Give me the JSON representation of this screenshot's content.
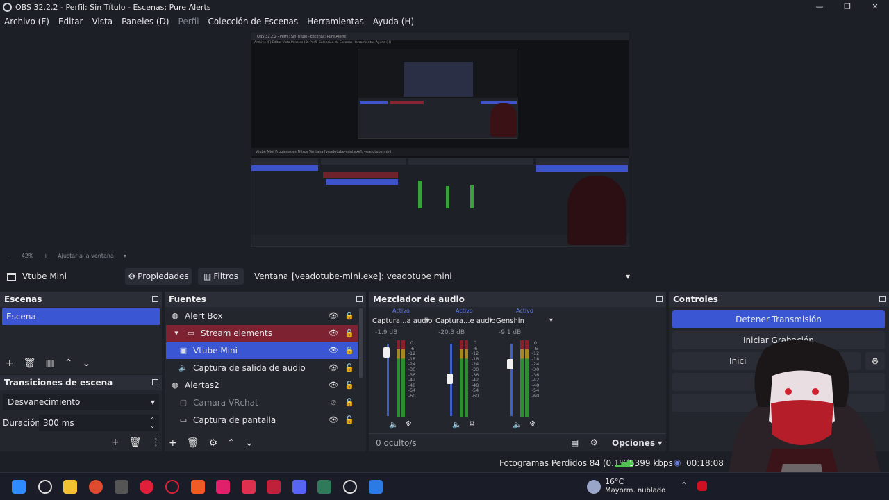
{
  "window": {
    "title": "OBS 32.2.2 - Perfil: Sin Título - Escenas: Pure Alerts",
    "controls": [
      "—",
      "❐",
      "✕"
    ]
  },
  "menu": [
    "Archivo (F)",
    "Editar",
    "Vista",
    "Paneles (D)",
    "Perfil",
    "Colección de Escenas",
    "Herramientas",
    "Ayuda (H)"
  ],
  "zoom": {
    "minus": "−",
    "level": "42%",
    "plus": "+",
    "fit": "Ajustar a la ventana"
  },
  "source_bar": {
    "current": "Vtube Mini",
    "properties": "Propiedades",
    "filters": "Filtros",
    "window_label": "Ventana",
    "window_value": "[veadotube-mini.exe]: veadotube mini"
  },
  "scenes": {
    "header": "Escenas",
    "items": [
      "Escena"
    ]
  },
  "transitions": {
    "header": "Transiciones de escena",
    "selected": "Desvanecimiento",
    "duration_label": "Duración",
    "duration_value": "300 ms"
  },
  "sources": {
    "header": "Fuentes",
    "items": [
      {
        "name": "Alert Box",
        "icon": "globe-icon"
      },
      {
        "name": "Stream elements",
        "icon": "folder-icon"
      },
      {
        "name": "Vtube Mini",
        "icon": "window-icon"
      },
      {
        "name": "Captura de salida de audio",
        "icon": "speaker-icon"
      },
      {
        "name": "Alertas2",
        "icon": "globe-icon"
      },
      {
        "name": "Camara VRchat",
        "icon": "camera-icon"
      },
      {
        "name": "Captura de pantalla",
        "icon": "monitor-icon"
      }
    ]
  },
  "mixer": {
    "header": "Mezclador de audio",
    "channels": [
      {
        "active": "Activo",
        "name": "Captura...a audio",
        "db": "-1.9 dB",
        "fader": 0.95
      },
      {
        "active": "Activo",
        "name": "Captura...e audio",
        "db": "-20.3 dB",
        "fader": 0.55
      },
      {
        "active": "Activo",
        "name": "Genshin",
        "db": "-9.1 dB",
        "fader": 0.77
      }
    ],
    "scale": [
      "0",
      "-6",
      "-12",
      "-18",
      "-24",
      "-30",
      "-36",
      "-42",
      "-48",
      "-54",
      "-60"
    ],
    "hidden": "0 oculto/s",
    "options": "Opciones"
  },
  "controls": {
    "header": "Controles",
    "stop_stream": "Detener Transmisión",
    "start_record": "Iniciar Grabación",
    "partial": "Inici"
  },
  "status": {
    "dropped": "Fotogramas Perdidos 84 (0.1%)",
    "bitrate": "5399 kbps",
    "time": "00:18:08"
  },
  "taskbar": {
    "weather_temp": "16°C",
    "weather_desc": "Mayorm. nublado"
  },
  "preview": {
    "title": "OBS 32.2.2 - Perfil: Sin Título - Escenas: Pure Alerts",
    "menu": "Archivo (F)  Editar  Vista  Paneles (D)  Perfil  Colección de Escenas  Herramientas  Ayuda (H)",
    "zoom": "−  42%  +  Ajustar a la ventana",
    "source": "Vtube Mini   Propiedades   Filtros   Ventana  [veadotube-mini.exe]: veadotube mini"
  }
}
